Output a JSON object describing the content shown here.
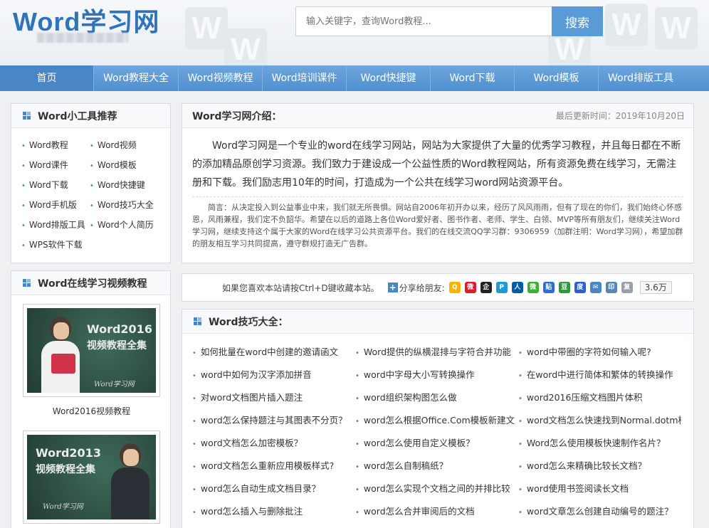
{
  "header": {
    "logo": "Word学习网",
    "search_placeholder": "输入关键字，查询Word教程...",
    "search_button": "搜索"
  },
  "nav": [
    "首页",
    "Word教程大全",
    "Word视频教程",
    "Word培训课件",
    "Word快捷键",
    "Word下载",
    "Word模板",
    "Word排版工具"
  ],
  "tools": {
    "title": "Word小工具推荐",
    "items": [
      "Word教程",
      "Word视频",
      "Word课件",
      "Word模板",
      "Word下载",
      "Word快捷键",
      "Word手机版",
      "Word技巧大全",
      "Word排版工具",
      "Word个人简历",
      "WPS软件下载"
    ]
  },
  "videos": {
    "title": "Word在线学习视频教程",
    "items": [
      {
        "line1": "Word2016",
        "line2": "视频教程全集",
        "sig": "Word学习网",
        "caption": "Word2016视频教程"
      },
      {
        "line1": "Word2013",
        "line2": "视频教程全集",
        "sig": "Word学习网",
        "caption": ""
      }
    ]
  },
  "intro": {
    "title": "Word学习网介绍：",
    "updated": "最后更新时间：2019年10月20日",
    "text": "Word学习网是一个专业的word在线学习网站，网站为大家提供了大量的优秀学习教程，并且每日都在不断的添加精品原创学习资源。我们致力于建设成一个公益性质的Word教程网站，所有资源免费在线学习，无需注册和下载。我们励志用10年的时间，打造成为一个公共在线学习word网站资源平台。",
    "note": "简言：从决定投入到公益事业中来，我们就无所畏惧。网站自2006年初开办以来，经历了风风雨雨，但有了现在的你们，我们始终心怀感恩，风雨兼程，我们定不负韶华。希望在以后的道路上各位Word爱好者、图书作者、老师、学生、白领、MVP等所有朋友们，继续关注Word学习网，继续支持这个属于大家的Word在线学习公共资源平台。我们的在线交流QQ学习群：9306959（加群注明：Word学习网），希望加群的朋友相互学习共同提高，遵守群规打造无广告群。"
  },
  "share": {
    "text": "如果您喜欢本站请按Ctrl+D键收藏本站。",
    "label": "分享给朋友:",
    "count": "3.6万",
    "icons": [
      {
        "name": "qzone-icon",
        "color": "#f5b400",
        "glyph": "Q"
      },
      {
        "name": "weibo-icon",
        "color": "#e6162d",
        "glyph": "微"
      },
      {
        "name": "qq-icon",
        "color": "#222222",
        "glyph": "企"
      },
      {
        "name": "tqq-icon",
        "color": "#1c9bd7",
        "glyph": "P"
      },
      {
        "name": "renren-icon",
        "color": "#005baa",
        "glyph": "人"
      },
      {
        "name": "wechat-icon",
        "color": "#3cb034",
        "glyph": "微"
      },
      {
        "name": "tieba-icon",
        "color": "#2c6bd8",
        "glyph": "贴"
      },
      {
        "name": "douban-icon",
        "color": "#2b9a3b",
        "glyph": "豆"
      },
      {
        "name": "baidu-icon",
        "color": "#2f5fd8",
        "glyph": "度"
      },
      {
        "name": "mail-icon",
        "color": "#4a86c6",
        "glyph": "✉"
      },
      {
        "name": "print-icon",
        "color": "#5a84b4",
        "glyph": "印"
      },
      {
        "name": "copy-icon",
        "color": "#9aa0a6",
        "glyph": "复"
      }
    ]
  },
  "tips": {
    "title": "Word技巧大全：",
    "items": [
      "如何批量在word中创建的邀请函文",
      "Word提供的纵横混排与字符合并功能",
      "word中带圈的字符如何输入呢?",
      "word中如何为汉字添加拼音",
      "word中字母大小写转换操作",
      "在word中进行简体和繁体的转换操作",
      "对word文档图片插入题注",
      "word组织架构图怎么做",
      "word2016压缩文档图片体积",
      "word怎么保持题注与其图表不分页？",
      "word怎么根据Office.Com模板新建文",
      "word文档怎么快速找到Normal.dotm模",
      "word文档怎么加密模板？",
      "word怎么使用自定义模板？",
      "Word怎么使用模板快速制作名片？",
      "word文档怎么重新应用模板样式?",
      "word怎么自制稿纸？",
      "word怎么来精确比较长文档？",
      "word怎么自动生成文档目录？",
      "word怎么实现个文档之间的并排比较",
      "word使用书签阅读长文档",
      "word怎么插入与删除批注",
      "word怎么合并审阅后的文档",
      "word文章怎么创建自动编号的题注？"
    ]
  }
}
